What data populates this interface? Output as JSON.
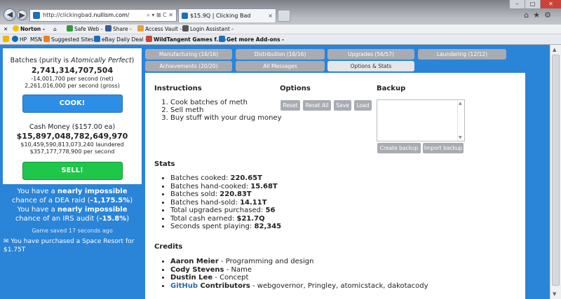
{
  "browser": {
    "url_prefix": "http://clickingbad.",
    "url_host": "nullism.com",
    "url_suffix": "/",
    "tab_title": "$15.9Q | Clicking Bad",
    "colors": {
      "chrome": "#b9bcc3"
    }
  },
  "toolbar1": {
    "norton": "Norton -",
    "safe_web": "Safe Web -",
    "share": "Share -",
    "access_vault": "Access Vault -",
    "login_assistant": "Login Assistant -"
  },
  "toolbar2": {
    "hp": "HP",
    "msn": "MSN",
    "suggested": "Suggested Sites -",
    "ebay": "eBay Daily Deal -",
    "wildtangent": "WildTangent Games f... -",
    "addons": "Get more Add-ons -"
  },
  "left": {
    "batches_prefix": "Batches (purity is ",
    "batches_purity": "Atomically Perfect",
    "batches_suffix": ")",
    "batches_count": "2,741,314,707,504",
    "batches_net": "-14,001,700 per second (net)",
    "batches_gross": "2,261,016,000 per second (gross)",
    "cook_label": "COOK!",
    "cash_head": "Cash Money ($157.00 ea)",
    "cash_count": "$15,897,048,782,649,970",
    "cash_laundered": "$10,459,590,813,073,240 laundered",
    "cash_rate": "$357,177,778,900 per second",
    "sell_label": "SELL!",
    "dea_1": "You have a ",
    "dea_2": "nearly impossible",
    "dea_3": "chance of a DEA raid (",
    "dea_4": "-1,175.5%",
    "dea_5": ")",
    "irs_1": "You have a ",
    "irs_2": "nearly impossible",
    "irs_3": "chance of an IRS audit (",
    "irs_4": "-15.8%",
    "irs_5": ")",
    "saved": "Game saved 17 seconds ago",
    "purchase": "You have purchased a Space Resort for $1.75T"
  },
  "tabs": {
    "manufacturing": "Manufacturing (16/16)",
    "distribution": "Distribution (16/16)",
    "upgrades": "Upgrades (56/57)",
    "laundering": "Laundering (12/12)",
    "achievements": "Achievements (20/20)",
    "messages": "All Messages",
    "options": "Options & Stats"
  },
  "instructions": {
    "title": "Instructions",
    "steps": [
      "Cook batches of meth",
      "Sell meth",
      "Buy stuff with your drug money"
    ]
  },
  "options": {
    "title": "Options",
    "reset": "Reset",
    "reset_all": "Reset All",
    "save": "Save",
    "load": "Load"
  },
  "backup": {
    "title": "Backup",
    "create": "Create backup",
    "import": "Import backup"
  },
  "stats": {
    "title": "Stats",
    "items": [
      {
        "label": "Batches cooked: ",
        "value": "220.65T"
      },
      {
        "label": "Batches hand-cooked: ",
        "value": "15.68T"
      },
      {
        "label": "Batches sold: ",
        "value": "220.83T"
      },
      {
        "label": "Batches hand-sold: ",
        "value": "14.11T"
      },
      {
        "label": "Total upgrades purchased: ",
        "value": "56"
      },
      {
        "label": "Total cash earned: ",
        "value": "$21.7Q"
      },
      {
        "label": "Seconds spent playing: ",
        "value": "82,345"
      }
    ]
  },
  "credits": {
    "title": "Credits",
    "items": [
      {
        "name": "Aaron Meier",
        "role": " - Programming and design"
      },
      {
        "name": "Cody Stevens",
        "role": " - Name"
      },
      {
        "name": "Dustin Lee",
        "role": " - Concept"
      }
    ],
    "github": "GitHub",
    "contributors": " Contributors",
    "contributors_list": " - webgovernor, Pringley, atomicstack, dakotacody"
  }
}
